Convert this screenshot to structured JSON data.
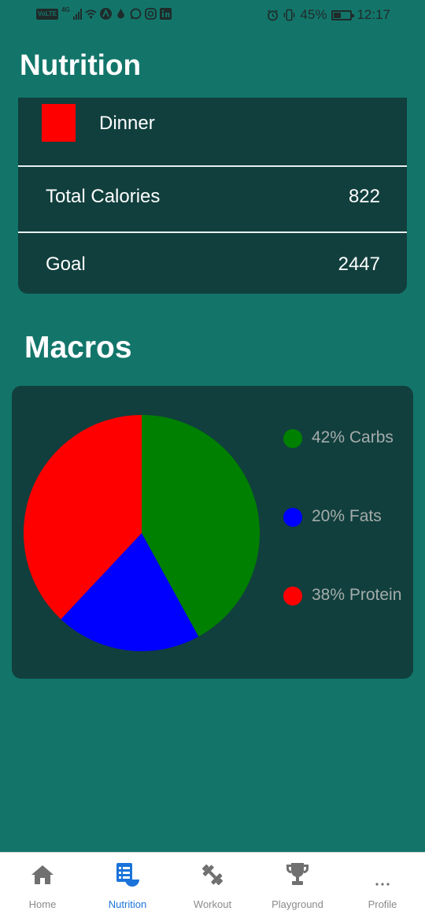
{
  "status_bar": {
    "volte": "VoLTE",
    "network": "4G",
    "battery_percent": "45%",
    "battery_level": 0.45,
    "time": "12:17",
    "icons": [
      "signal-icon",
      "wifi-icon",
      "app-icon",
      "drop-icon",
      "whatsapp-icon",
      "instagram-icon",
      "linkedin-icon",
      "alarm-icon",
      "vibrate-icon",
      "battery-icon"
    ]
  },
  "page": {
    "title": "Nutrition"
  },
  "nutrition_card": {
    "meal": {
      "name": "Dinner",
      "color": "#ff0000"
    },
    "total_calories": {
      "label": "Total Calories",
      "value": "822"
    },
    "goal": {
      "label": "Goal",
      "value": "2447"
    }
  },
  "macros": {
    "title": "Macros",
    "legend": [
      {
        "text": "42% Carbs",
        "color": "#008000"
      },
      {
        "text": "20% Fats",
        "color": "#0000ff"
      },
      {
        "text": "38% Protein",
        "color": "#ff0000"
      }
    ]
  },
  "chart_data": {
    "type": "pie",
    "categories": [
      "Carbs",
      "Fats",
      "Protein"
    ],
    "values": [
      42,
      20,
      38
    ],
    "colors": [
      "#008000",
      "#0000ff",
      "#ff0000"
    ],
    "legend_position": "right"
  },
  "bottom_nav": {
    "active_color": "#1a73d9",
    "items": [
      {
        "label": "Home",
        "icon": "home-icon"
      },
      {
        "label": "Nutrition",
        "icon": "nutrition-icon"
      },
      {
        "label": "Workout",
        "icon": "dumbbell-icon"
      },
      {
        "label": "Playground",
        "icon": "trophy-icon"
      },
      {
        "label": "Profile",
        "icon": "more-icon"
      }
    ]
  }
}
